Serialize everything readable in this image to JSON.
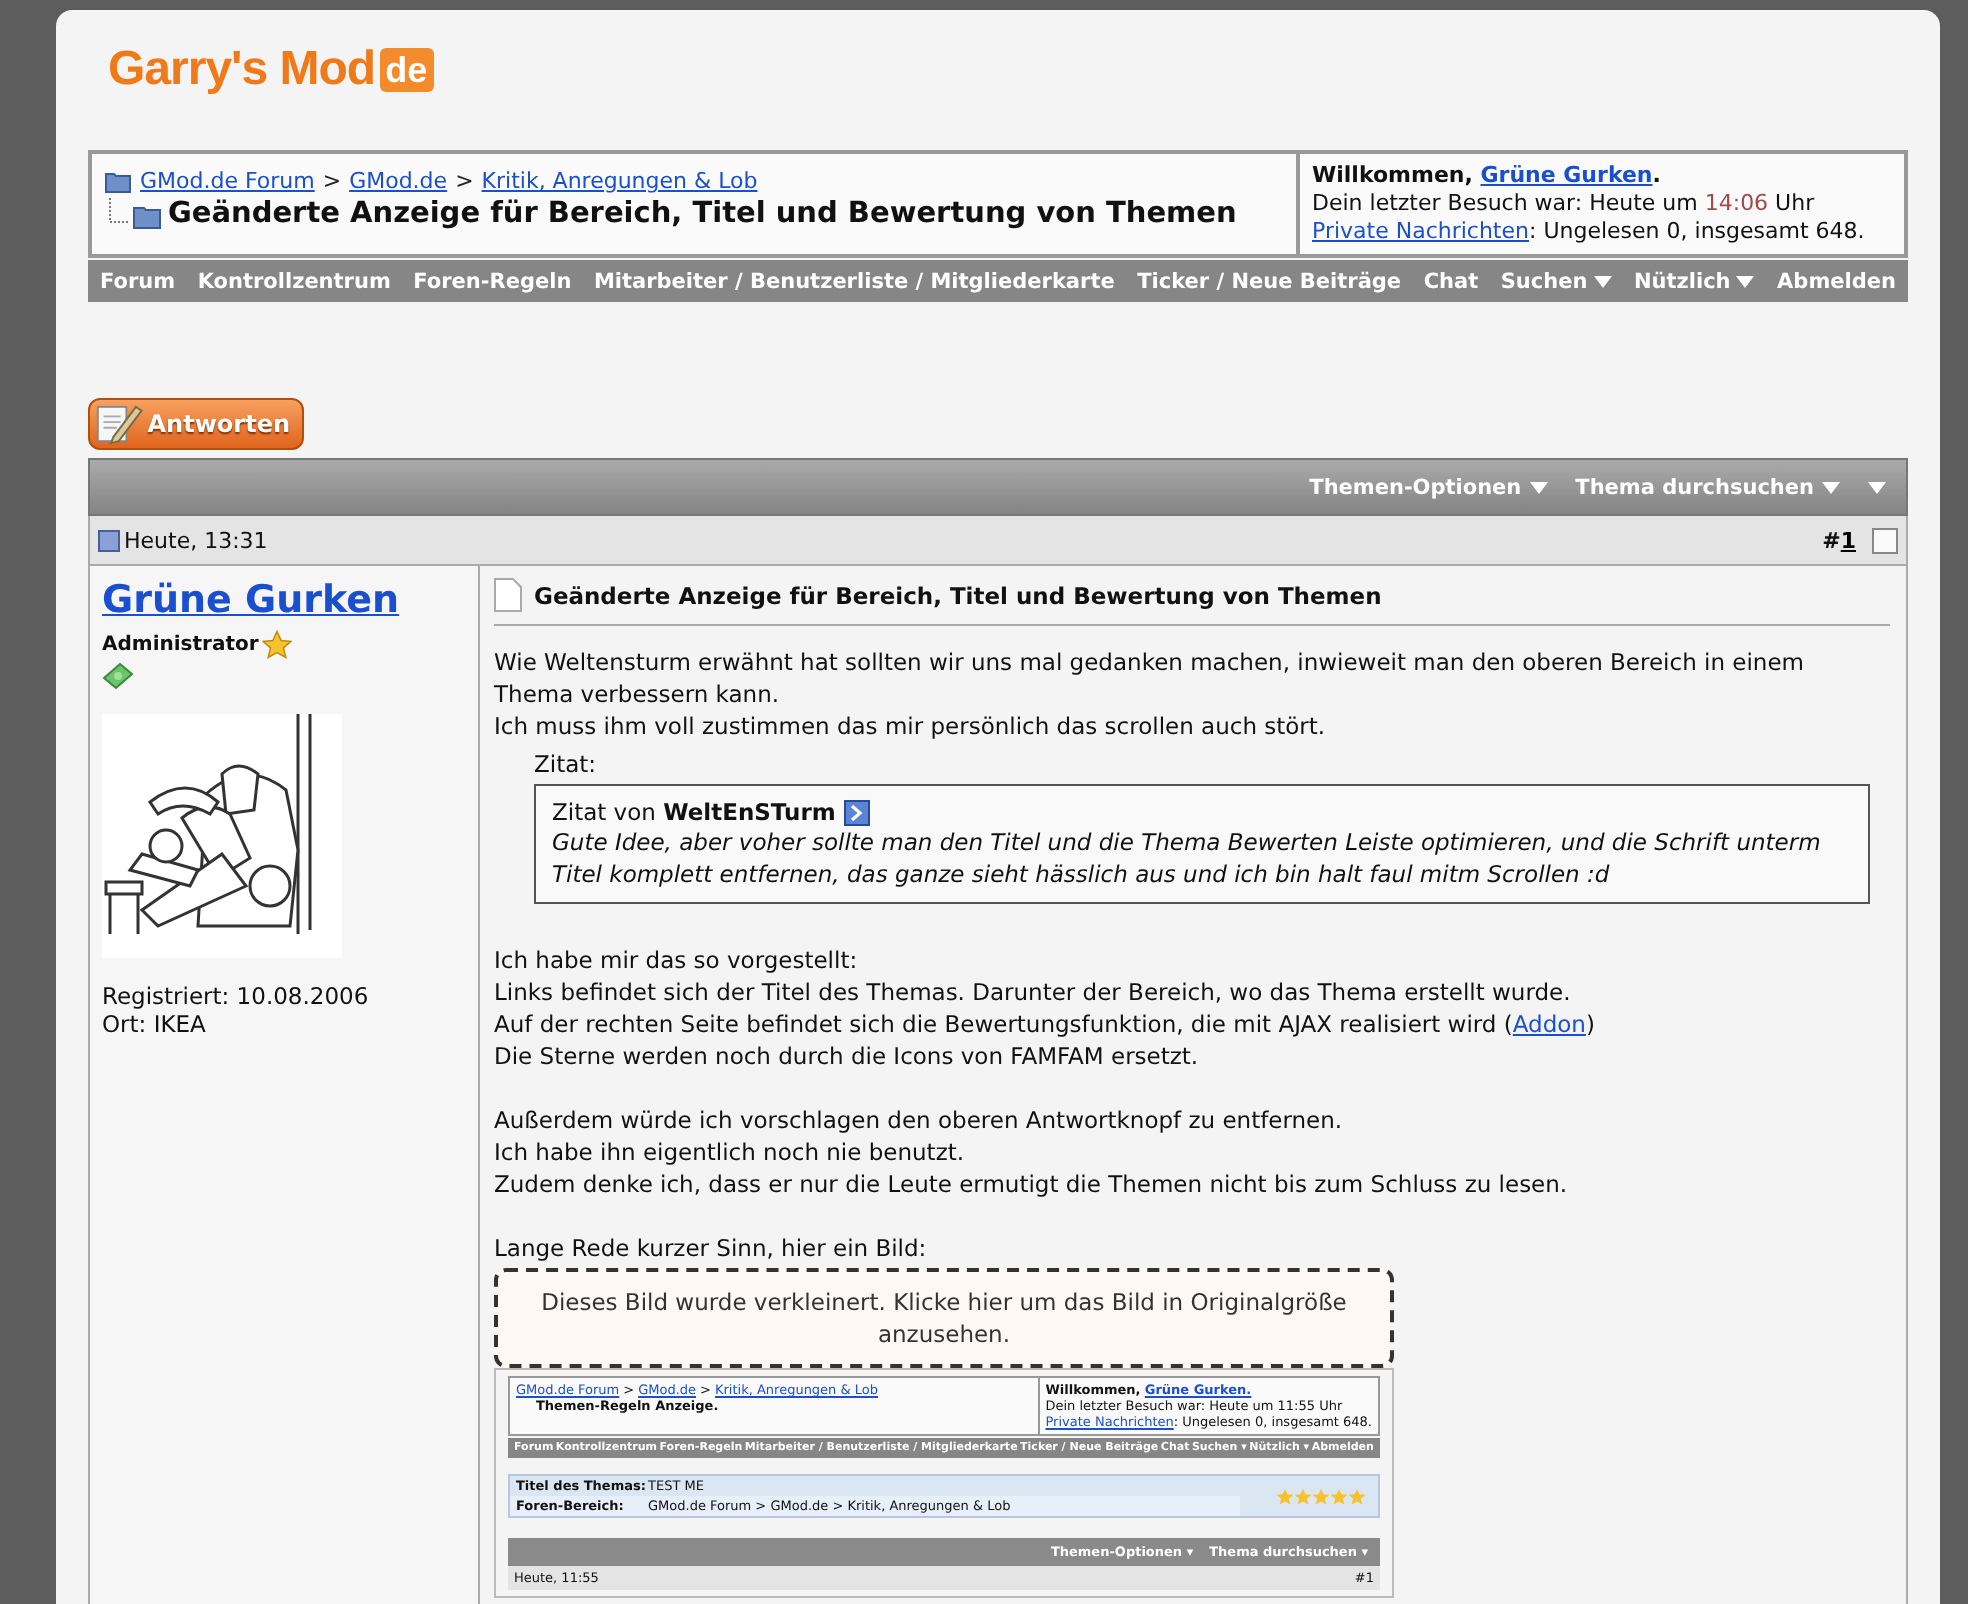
{
  "logo": {
    "text": "Garry's Mod",
    "badge": "de"
  },
  "breadcrumb": {
    "items": [
      "GMod.de Forum",
      "GMod.de",
      "Kritik, Anregungen & Lob"
    ],
    "separator": ">",
    "title": "Geänderte Anzeige für Bereich, Titel und Bewertung von Themen"
  },
  "welcome": {
    "greeting": "Willkommen,",
    "user": "Grüne Gurken",
    "end": ".",
    "visit_label": "Dein letzter Besuch war: Heute um",
    "visit_time": "14:06",
    "visit_unit": "Uhr",
    "pm_link": "Private Nachrichten",
    "pm_text": ": Ungelesen 0, insgesamt 648."
  },
  "nav": [
    {
      "label": "Forum",
      "dropdown": false
    },
    {
      "label": "Kontrollzentrum",
      "dropdown": false
    },
    {
      "label": "Foren-Regeln",
      "dropdown": false
    },
    {
      "label": "Mitarbeiter / Benutzerliste / Mitgliederkarte",
      "dropdown": false
    },
    {
      "label": "Ticker / Neue Beiträge",
      "dropdown": false
    },
    {
      "label": "Chat",
      "dropdown": false
    },
    {
      "label": "Suchen",
      "dropdown": true
    },
    {
      "label": "Nützlich",
      "dropdown": true
    },
    {
      "label": "Abmelden",
      "dropdown": false
    }
  ],
  "reply_button": "Antworten",
  "thread_tools": [
    "Themen-Optionen",
    "Thema durchsuchen"
  ],
  "post": {
    "date": "Heute, 13:31",
    "number_prefix": "#",
    "number": "1",
    "selected": false,
    "author": {
      "name": "Grüne Gurken",
      "rank": "Administrator",
      "registered": "Registriert: 10.08.2006",
      "location": "Ort: IKEA"
    },
    "title": "Geänderte Anzeige für Bereich, Titel und Bewertung von Themen",
    "blocks": [
      {
        "kind": "text",
        "lines": [
          {
            "text": "Wie Weltensturm erwähnt hat sollten wir uns mal gedanken machen, inwieweit man den oberen Bereich in einem Thema verbessern kann."
          },
          {
            "text": "Ich muss ihm voll zustimmen das mir persönlich das scrollen auch stört."
          }
        ]
      },
      {
        "kind": "quote",
        "label": "Zitat:",
        "from": "Zitat von",
        "author": "WeltEnSTurm",
        "text": "Gute Idee, aber voher sollte man den Titel und die Thema Bewerten Leiste optimieren, und die Schrift unterm Titel komplett entfernen, das ganze sieht hässlich aus und ich bin halt faul mitm Scrollen :d"
      },
      {
        "kind": "text",
        "lines": [
          {
            "text": "Ich habe mir das so vorgestellt:"
          },
          {
            "text": "Links befindet sich der Titel des Themas. Darunter der Bereich, wo das Thema erstellt wurde."
          },
          {
            "text": "Auf der rechten Seite befindet sich die Bewertungsfunktion, die mit AJAX realisiert wird (",
            "link": "Addon",
            "after": ")"
          },
          {
            "text": "Die Sterne werden noch durch die Icons von FAMFAM ersetzt."
          }
        ]
      },
      {
        "kind": "text",
        "lines": [
          {
            "text": "Außerdem würde ich vorschlagen den oberen Antwortknopf zu entfernen."
          },
          {
            "text": "Ich habe ihn eigentlich noch nie benutzt."
          },
          {
            "text": "Zudem denke ich, dass er nur die Leute ermutigt die Themen nicht bis zum Schluss zu lesen."
          }
        ]
      },
      {
        "kind": "text",
        "lines": [
          {
            "text": "Lange Rede kurzer Sinn, hier ein Bild:"
          }
        ]
      },
      {
        "notice": "Dieses Bild wurde verkleinert. Klicke hier um das Bild in Originalgröße anzusehen.",
        "shot": {
          "breadcrumb": [
            "GMod.de Forum",
            "GMod.de",
            "Kritik, Anregungen & Lob"
          ],
          "separator": ">",
          "title": "Themen-Regeln Anzeige.",
          "greeting": "Willkommen,",
          "user": "Grüne Gurken.",
          "visit": "Dein letzter Besuch war: Heute um 11:55 Uhr",
          "pm_link": "Private Nachrichten",
          "pm_text": ": Ungelesen 0, insgesamt 648.",
          "nav": [
            "Forum",
            "Kontrollzentrum",
            "Foren-Regeln",
            "Mitarbeiter / Benutzerliste / Mitgliederkarte",
            "Ticker / Neue Beiträge",
            "Chat",
            "Suchen ▾",
            "Nützlich ▾",
            "Abmelden"
          ],
          "info": [
            {
              "label": "Titel des Themas:",
              "value": "TEST ME"
            },
            {
              "label": "Foren-Bereich:",
              "value": "GMod.de Forum > GMod.de > Kritik, Anregungen & Lob"
            }
          ],
          "stars": 5,
          "tools": [
            "Themen-Optionen ▾",
            "Thema durchsuchen ▾"
          ],
          "date": "Heute, 11:55",
          "number": "#1"
        }
      }
    ]
  }
}
